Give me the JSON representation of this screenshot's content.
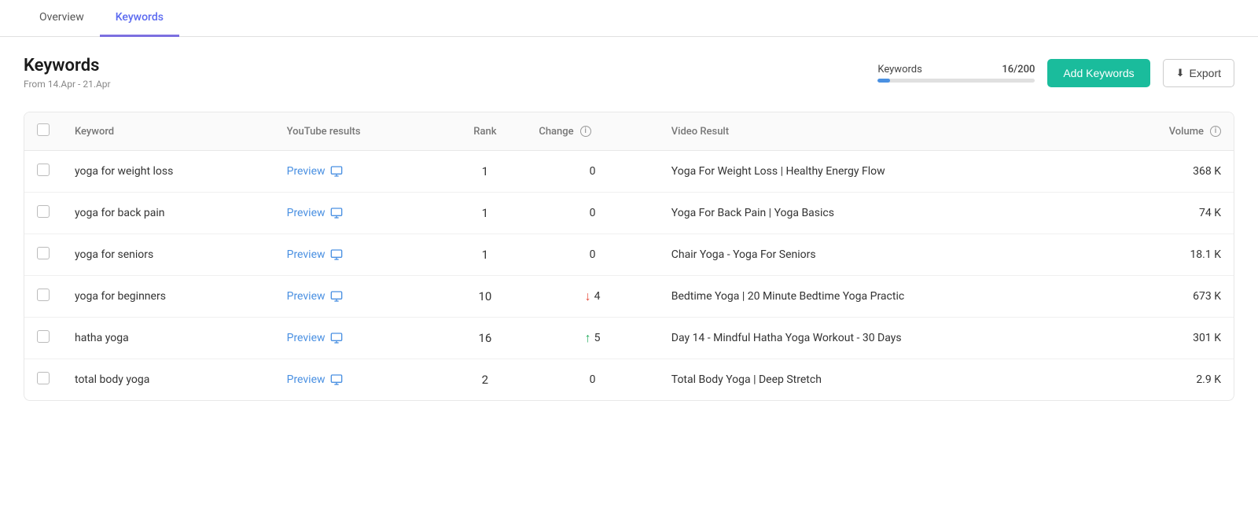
{
  "tabs": [
    {
      "id": "overview",
      "label": "Overview",
      "active": false
    },
    {
      "id": "keywords",
      "label": "Keywords",
      "active": true
    }
  ],
  "header": {
    "title": "Keywords",
    "subtitle": "From 14.Apr - 21.Apr",
    "keywords_label": "Keywords",
    "keywords_count": "16/200",
    "progress_percent": 8,
    "add_button": "Add Keywords",
    "export_button": "Export"
  },
  "table": {
    "columns": [
      {
        "id": "checkbox",
        "label": ""
      },
      {
        "id": "keyword",
        "label": "Keyword"
      },
      {
        "id": "youtube",
        "label": "YouTube results"
      },
      {
        "id": "rank",
        "label": "Rank"
      },
      {
        "id": "change",
        "label": "Change"
      },
      {
        "id": "video_result",
        "label": "Video Result"
      },
      {
        "id": "volume",
        "label": "Volume"
      }
    ],
    "rows": [
      {
        "keyword": "yoga for weight loss",
        "youtube": "Preview",
        "rank": "1",
        "change_value": "0",
        "change_direction": "none",
        "video_result": "Yoga For Weight Loss | Healthy Energy Flow",
        "volume": "368 K"
      },
      {
        "keyword": "yoga for back pain",
        "youtube": "Preview",
        "rank": "1",
        "change_value": "0",
        "change_direction": "none",
        "video_result": "Yoga For Back Pain | Yoga Basics",
        "volume": "74 K"
      },
      {
        "keyword": "yoga for seniors",
        "youtube": "Preview",
        "rank": "1",
        "change_value": "0",
        "change_direction": "none",
        "video_result": "Chair Yoga - Yoga For Seniors",
        "volume": "18.1 K"
      },
      {
        "keyword": "yoga for beginners",
        "youtube": "Preview",
        "rank": "10",
        "change_value": "4",
        "change_direction": "down",
        "video_result": "Bedtime Yoga | 20 Minute Bedtime Yoga Practic",
        "volume": "673 K"
      },
      {
        "keyword": "hatha yoga",
        "youtube": "Preview",
        "rank": "16",
        "change_value": "5",
        "change_direction": "up",
        "video_result": "Day 14 - Mindful Hatha Yoga Workout - 30 Days",
        "volume": "301 K"
      },
      {
        "keyword": "total body yoga",
        "youtube": "Preview",
        "rank": "2",
        "change_value": "0",
        "change_direction": "none",
        "video_result": "Total Body Yoga | Deep Stretch",
        "volume": "2.9 K"
      }
    ]
  }
}
